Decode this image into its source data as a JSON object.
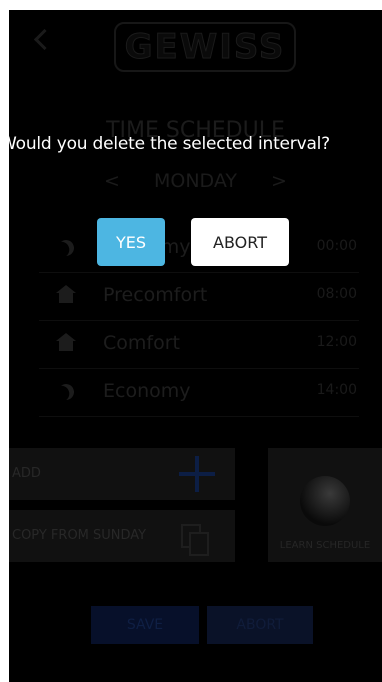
{
  "app": {
    "logo_text": "GEWISS",
    "title": "TIME SCHEDULE",
    "day_prev": "<",
    "day": "MONDAY",
    "day_next": ">"
  },
  "schedule": [
    {
      "icon": "moon-icon",
      "label": "Economy",
      "time": "00:00"
    },
    {
      "icon": "house-icon",
      "label": "Precomfort",
      "time": "08:00"
    },
    {
      "icon": "house-icon",
      "label": "Comfort",
      "time": "12:00"
    },
    {
      "icon": "moon-icon",
      "label": "Economy",
      "time": "14:00"
    }
  ],
  "actions": {
    "add_label": "ADD",
    "copy_label": "COPY FROM SUNDAY",
    "learn_label": "LEARN SCHEDULE",
    "save_label": "SAVE",
    "abort_label": "ABORT"
  },
  "dialog": {
    "question": "Would you delete the selected interval?",
    "yes_label": "YES",
    "abort_label": "ABORT"
  },
  "colors": {
    "background": "#000000",
    "yes_button": "#4db6e2",
    "abort_button": "#ffffff",
    "text": "#ffffff"
  }
}
